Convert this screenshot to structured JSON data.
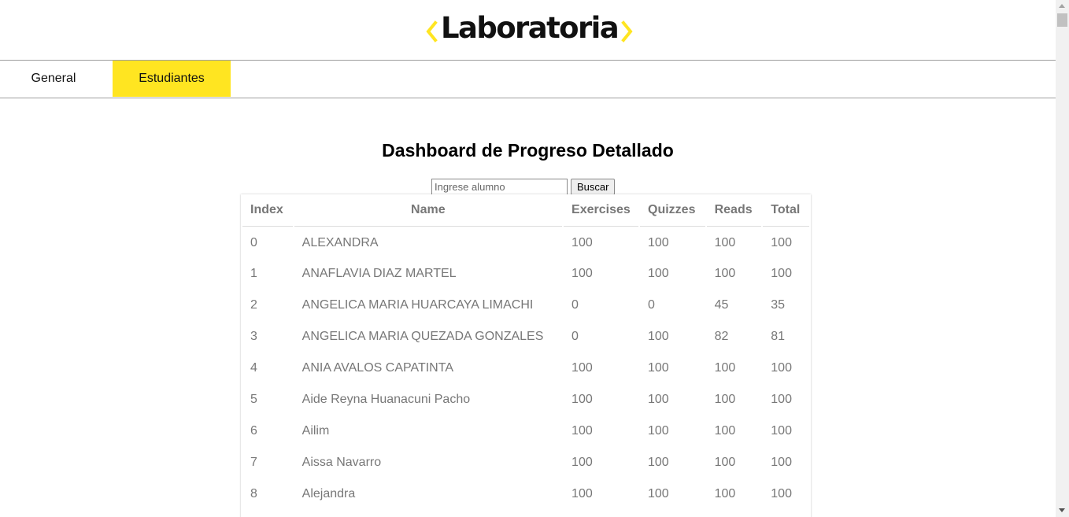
{
  "brand": {
    "name": "Laboratoria",
    "accent": "#ffe521"
  },
  "nav": {
    "tabs": [
      {
        "label": "General",
        "active": false
      },
      {
        "label": "Estudiantes",
        "active": true
      }
    ]
  },
  "main": {
    "title": "Dashboard de Progreso Detallado",
    "search": {
      "placeholder": "Ingrese alumno",
      "value": "",
      "button_label": "Buscar"
    },
    "table": {
      "columns": [
        "Index",
        "Name",
        "Exercises",
        "Quizzes",
        "Reads",
        "Total"
      ],
      "rows": [
        [
          "0",
          "ALEXANDRA",
          "100",
          "100",
          "100",
          "100"
        ],
        [
          "1",
          "ANAFLAVIA DIAZ MARTEL",
          "100",
          "100",
          "100",
          "100"
        ],
        [
          "2",
          "ANGELICA MARIA HUARCAYA LIMACHI",
          "0",
          "0",
          "45",
          "35"
        ],
        [
          "3",
          "ANGELICA MARIA QUEZADA GONZALES",
          "0",
          "100",
          "82",
          "81"
        ],
        [
          "4",
          "ANIA AVALOS CAPATINTA",
          "100",
          "100",
          "100",
          "100"
        ],
        [
          "5",
          "Aide Reyna Huanacuni Pacho",
          "100",
          "100",
          "100",
          "100"
        ],
        [
          "6",
          "Ailim",
          "100",
          "100",
          "100",
          "100"
        ],
        [
          "7",
          "Aissa Navarro",
          "100",
          "100",
          "100",
          "100"
        ],
        [
          "8",
          "Alejandra",
          "100",
          "100",
          "100",
          "100"
        ]
      ]
    }
  }
}
